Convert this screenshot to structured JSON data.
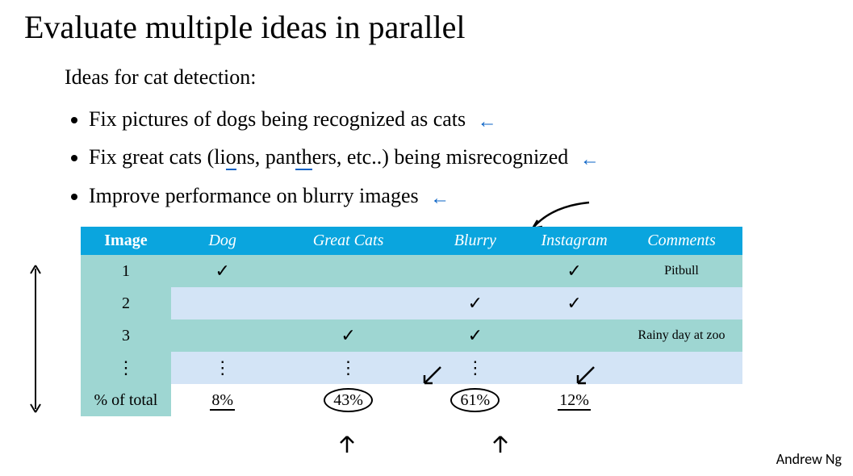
{
  "title": "Evaluate multiple ideas in parallel",
  "subhead": "Ideas for cat detection:",
  "ideas": [
    "Fix pictures of dogs being recognized as cats",
    "Fix great cats (lions, panthers, etc..) being misrecognized",
    "Improve performance on blurry images"
  ],
  "arrow_glyph": "←",
  "ellipsis_v": "⋮",
  "check_glyph": "✓",
  "table": {
    "headers": {
      "image": "Image",
      "dog": "Dog",
      "great_cats": "Great Cats",
      "blurry": "Blurry",
      "instagram": "Instagram",
      "comments": "Comments"
    },
    "rows": [
      {
        "idx": "1",
        "dog": "✓",
        "great_cats": "",
        "blurry": "",
        "instagram": "✓",
        "comments": "Pitbull"
      },
      {
        "idx": "2",
        "dog": "",
        "great_cats": "",
        "blurry": "✓",
        "instagram": "✓",
        "comments": ""
      },
      {
        "idx": "3",
        "dog": "",
        "great_cats": "✓",
        "blurry": "✓",
        "instagram": "",
        "comments": "Rainy day at zoo"
      },
      {
        "idx": "⋮",
        "dog": "⋮",
        "great_cats": "⋮",
        "blurry": "⋮",
        "instagram": "",
        "comments": ""
      }
    ],
    "footer": {
      "label": "% of total",
      "dog": "8%",
      "great_cats": "43%",
      "blurry": "61%",
      "instagram": "12%"
    }
  },
  "attribution": "Andrew Ng",
  "chart_data": {
    "type": "table",
    "title": "Error analysis spreadsheet",
    "columns": [
      "Image",
      "Dog",
      "Great Cats",
      "Blurry",
      "Instagram",
      "Comments"
    ],
    "rows": [
      [
        1,
        true,
        false,
        false,
        true,
        "Pitbull"
      ],
      [
        2,
        false,
        false,
        true,
        true,
        ""
      ],
      [
        3,
        false,
        true,
        true,
        false,
        "Rainy day at zoo"
      ]
    ],
    "footer_pct_of_total": {
      "Dog": 8,
      "Great Cats": 43,
      "Blurry": 61,
      "Instagram": 12
    }
  }
}
